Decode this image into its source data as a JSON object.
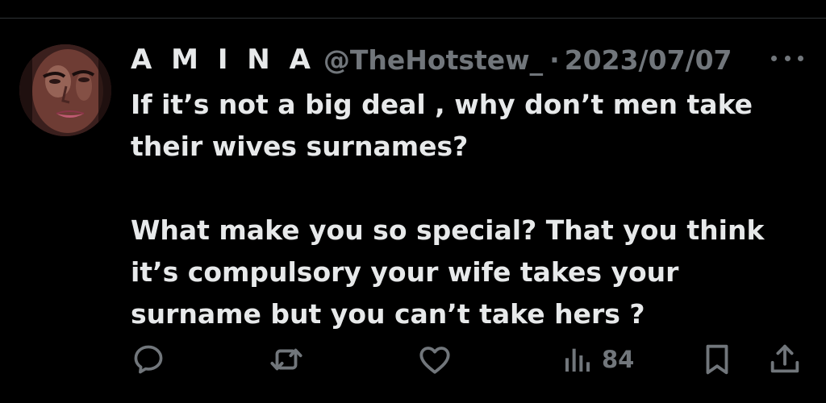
{
  "tweet": {
    "author": {
      "display_name": "A M I N A",
      "handle": "@TheHotstew_",
      "avatar": "profile-photo"
    },
    "separator": "·",
    "date": "2023/07/07",
    "paragraphs": [
      "If it’s not a big deal , why don’t men take their wives surnames?",
      "What make you so special? That you think it’s compulsory your wife takes your surname but you can’t take hers ?"
    ]
  },
  "actions": {
    "reply": {
      "icon": "reply-icon"
    },
    "retweet": {
      "icon": "retweet-icon"
    },
    "like": {
      "icon": "heart-icon"
    },
    "views": {
      "icon": "views-icon",
      "count": "84"
    },
    "bookmark": {
      "icon": "bookmark-icon"
    },
    "share": {
      "icon": "share-icon"
    }
  },
  "colors": {
    "background": "#000000",
    "text_primary": "#e7e9ea",
    "text_secondary": "#71767b",
    "divider": "#2f3336"
  }
}
